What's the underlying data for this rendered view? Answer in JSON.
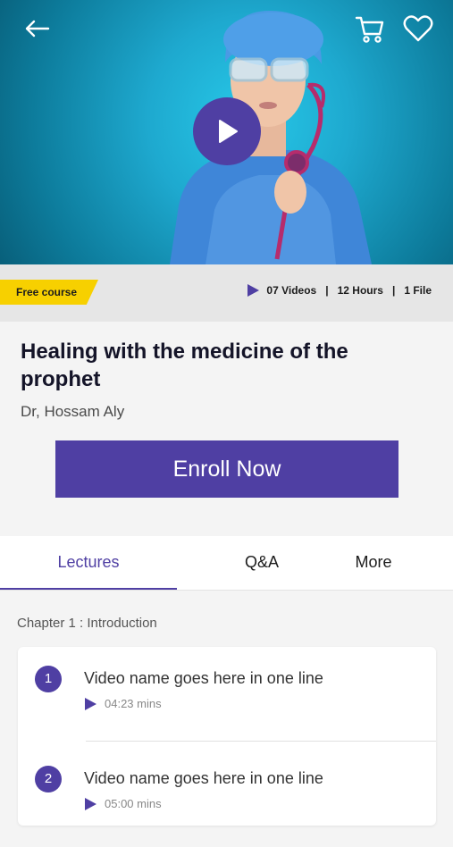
{
  "hero": {
    "icons": {
      "back": "arrow-left-icon",
      "cart": "shopping-cart-icon",
      "wishlist": "heart-icon",
      "play": "play-icon"
    }
  },
  "info": {
    "tag": "Free course",
    "videos": "07 Videos",
    "separator": "|",
    "hours": "12 Hours",
    "files": "1 File"
  },
  "course": {
    "title": "Healing with the medicine of the prophet",
    "instructor": "Dr, Hossam Aly",
    "enroll_label": "Enroll Now"
  },
  "tabs": [
    {
      "label": "Lectures",
      "active": true
    },
    {
      "label": "Q&A",
      "active": false
    },
    {
      "label": "More",
      "active": false
    }
  ],
  "chapter": {
    "label": "Chapter 1 : Introduction",
    "lectures": [
      {
        "number": "1",
        "name": "Video name goes here in one line",
        "duration": "04:23 mins"
      },
      {
        "number": "2",
        "name": "Video name goes here in one line",
        "duration": "05:00 mins"
      }
    ]
  },
  "colors": {
    "accent": "#4f3fa3",
    "tag": "#f7d000",
    "hero": "#1ea9cf"
  }
}
